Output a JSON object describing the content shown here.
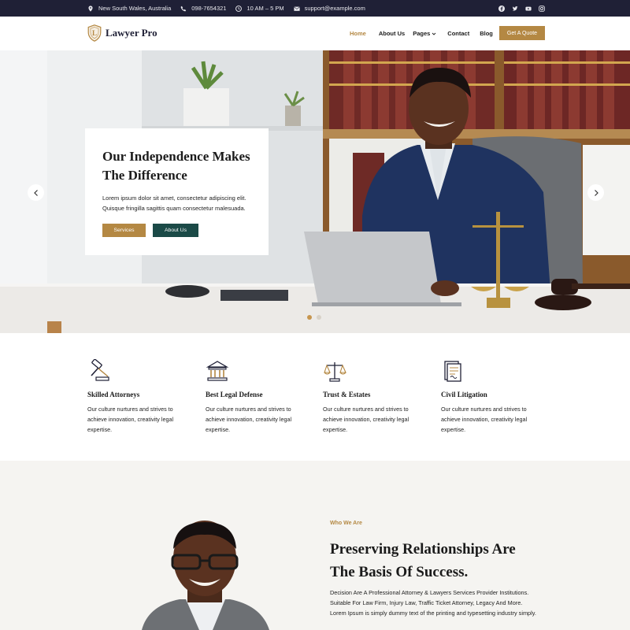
{
  "topbar": {
    "location": "New South Wales, Australia",
    "phone": "098-7654321",
    "hours": "10 AM – 5 PM",
    "email": "support@example.com",
    "social_icons": [
      "facebook-icon",
      "twitter-icon",
      "youtube-icon",
      "instagram-icon"
    ]
  },
  "header": {
    "brand": "Lawyer Pro",
    "nav": {
      "home": "Home",
      "about": "About Us",
      "pages": "Pages",
      "contact": "Contact",
      "blog": "Blog"
    },
    "quote_button": "Get A Quote"
  },
  "hero": {
    "title": "Our Independence Makes The Difference",
    "text": "Lorem ipsum dolor sit amet, consectetur adipiscing elit. Quisque fringilla sagittis quam consectetur malesuada.",
    "services_button": "Services",
    "about_button": "About Us",
    "prev_arrow": "‹",
    "next_arrow": "›",
    "slides_total": 2,
    "active_slide": 1
  },
  "features": [
    {
      "icon": "gavel-icon",
      "title": "Skilled Attorneys",
      "text": "Our culture nurtures and strives to achieve innovation, creativity legal expertise."
    },
    {
      "icon": "courthouse-icon",
      "title": "Best Legal Defense",
      "text": "Our culture nurtures and strives to achieve innovation, creativity legal expertise."
    },
    {
      "icon": "scales-icon",
      "title": "Trust & Estates",
      "text": "Our culture nurtures and strives to achieve innovation, creativity legal expertise."
    },
    {
      "icon": "document-icon",
      "title": "Civil Litigation",
      "text": "Our culture nurtures and strives to achieve innovation, creativity legal expertise."
    }
  ],
  "about": {
    "eyebrow": "Who We Are",
    "title": "Preserving Relationships Are The Basis Of Success.",
    "text": "Decision Are A Professional Attorney & Lawyers Services Provider Institutions. Suitable For Law Firm, Injury Law, Traffic Ticket Attorney, Legacy And More. Lorem Ipsum is simply dummy text of the printing and typesetting industry simply."
  },
  "colors": {
    "accent_gold": "#b48843",
    "dark_navy": "#1f2036",
    "teal": "#1b4a47"
  }
}
